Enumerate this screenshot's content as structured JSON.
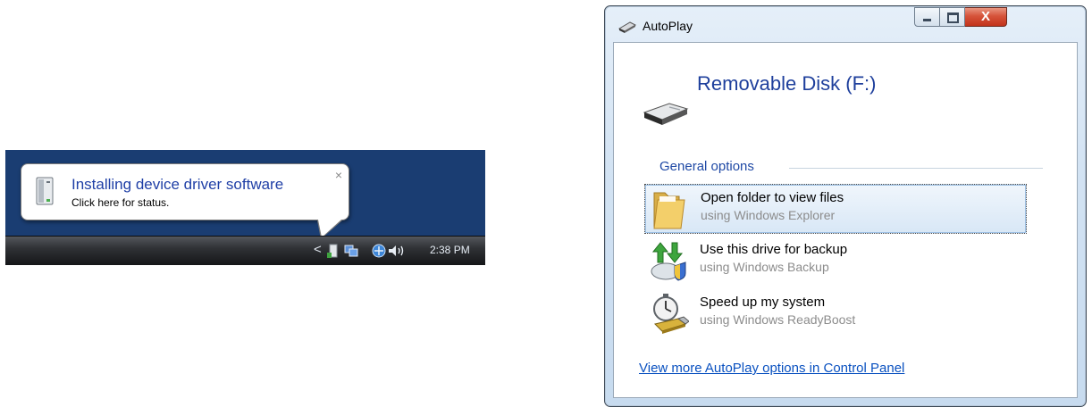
{
  "balloon": {
    "title": "Installing device driver software",
    "text": "Click here for status.",
    "close": "×"
  },
  "taskbar": {
    "chevron": "<",
    "time": "2:38 PM",
    "icons": [
      "device-installing-icon",
      "network-icon",
      "connection-icon",
      "volume-icon"
    ]
  },
  "window": {
    "title": "AutoPlay",
    "close_glyph": "X",
    "device": "Removable Disk (F:)",
    "group": "General options",
    "options": [
      {
        "title": "Open folder to view files",
        "subtitle": "using Windows Explorer",
        "icon": "folder-icon"
      },
      {
        "title": "Use this drive for backup",
        "subtitle": "using Windows Backup",
        "icon": "backup-icon"
      },
      {
        "title": "Speed up my system",
        "subtitle": "using Windows ReadyBoost",
        "icon": "readyboost-icon"
      }
    ],
    "link": "View more AutoPlay options in Control Panel"
  },
  "colors": {
    "desktop": "#1a3d72",
    "link": "#0a51c0",
    "heading": "#1e3f9c",
    "close_button": "#c2331b"
  }
}
